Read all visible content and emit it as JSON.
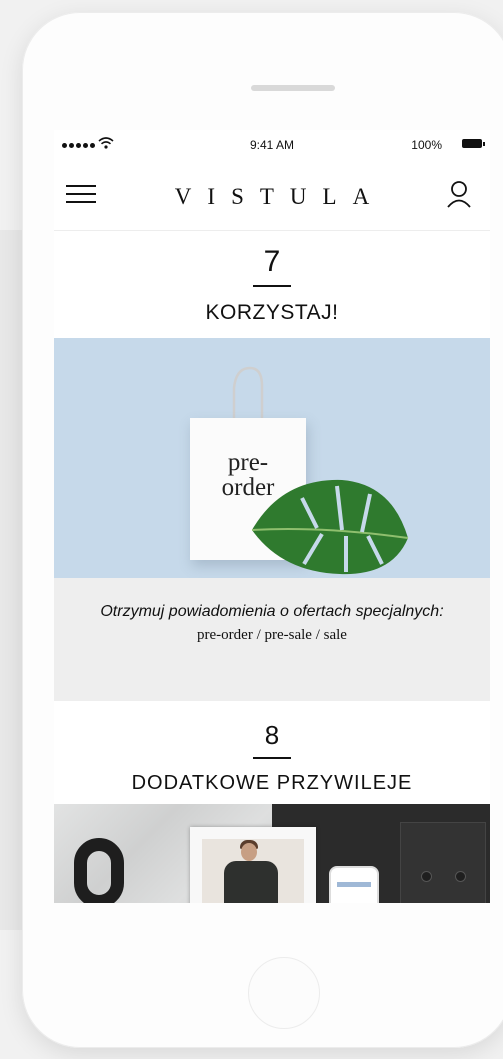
{
  "status_bar": {
    "time": "9:41 AM",
    "battery_percent": "100%"
  },
  "nav": {
    "brand": "VISTULA"
  },
  "section_7": {
    "number": "7",
    "title": "KORZYSTAJ!",
    "bag_text_line1": "pre-",
    "bag_text_line2": "order",
    "caption_line1": "Otrzymuj powiadomienia o ofertach specjalnych:",
    "caption_line2": "pre-order / pre-sale / sale"
  },
  "section_8": {
    "number": "8",
    "title": "DODATKOWE PRZYWILEJE"
  },
  "colors": {
    "hero_bg": "#c6d9ea",
    "caption_bg": "#eeeeee",
    "leaf_green": "#2f7a2e"
  },
  "icons": [
    "signal-icon",
    "wifi-icon",
    "battery-icon",
    "menu-icon",
    "user-icon"
  ]
}
